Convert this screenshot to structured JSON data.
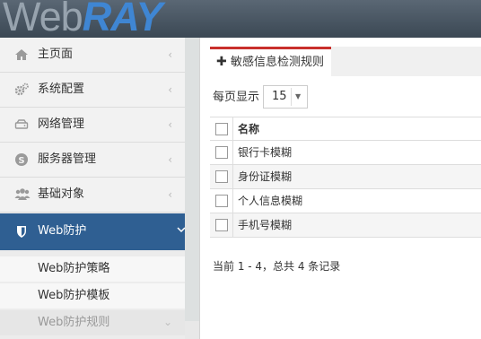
{
  "header": {
    "logo_web": "Web",
    "logo_ray": "RAY"
  },
  "sidebar": {
    "items": [
      {
        "label": "主页面",
        "icon": "home-icon"
      },
      {
        "label": "系统配置",
        "icon": "gears-icon"
      },
      {
        "label": "网络管理",
        "icon": "hdd-icon"
      },
      {
        "label": "服务器管理",
        "icon": "skype-icon"
      },
      {
        "label": "基础对象",
        "icon": "users-icon"
      },
      {
        "label": "Web防护",
        "icon": "shield-icon",
        "active": true
      }
    ],
    "subitems": [
      {
        "label": "Web防护策略"
      },
      {
        "label": "Web防护模板"
      },
      {
        "label": "Web防护规则"
      }
    ]
  },
  "main": {
    "tab": {
      "label": "敏感信息检测规则"
    },
    "pagesize": {
      "label": "每页显示",
      "value": "15"
    },
    "table": {
      "header": "名称",
      "rows": [
        "银行卡模糊",
        "身份证模糊",
        "个人信息模糊",
        "手机号模糊"
      ]
    },
    "pager": "当前 1 - 4，总共 4 条记录"
  }
}
